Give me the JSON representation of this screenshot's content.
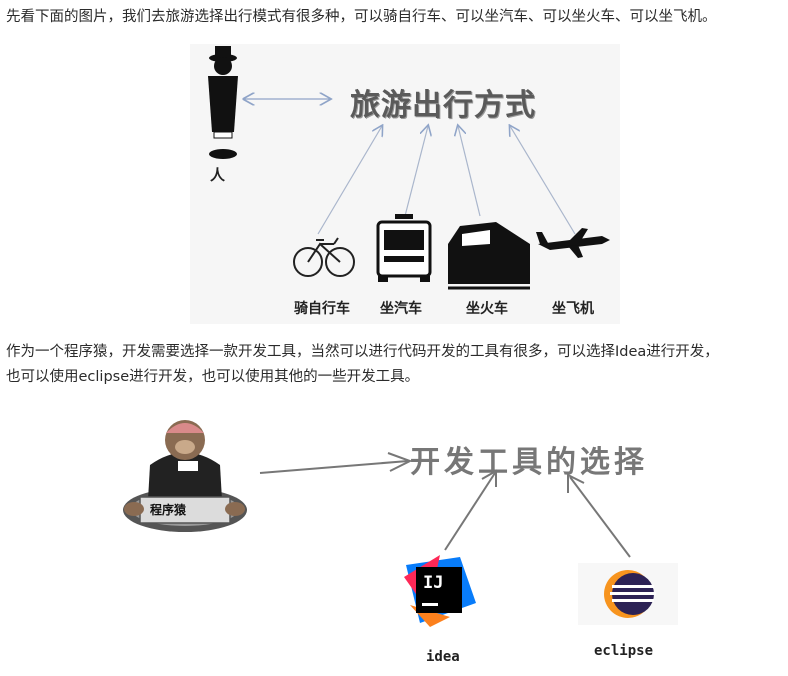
{
  "intro": {
    "line1": "先看下面的图片，我们去旅游选择出行模式有很多种，可以骑自行车、可以坐汽车、可以坐火车、可以坐飞机。",
    "line2": "作为一个程序猿，开发需要选择一款开发工具，当然可以进行代码开发的工具有很多，可以选择Idea进行开发，",
    "line3": "也可以使用eclipse进行开发，也可以使用其他的一些开发工具。"
  },
  "figure1": {
    "title": "旅游出行方式",
    "person_label": "人",
    "options": [
      "骑自行车",
      "坐汽车",
      "坐火车",
      "坐飞机"
    ]
  },
  "figure2": {
    "title": "开发工具的选择",
    "programmer_label": "程序猿",
    "tools": [
      "idea",
      "eclipse"
    ],
    "idea_logo_text": "IJ",
    "colors": {
      "eclipse_orange": "#f7941e",
      "eclipse_purple": "#2c2255",
      "idea_pink": "#fe2857",
      "idea_blue": "#087cfa"
    }
  }
}
